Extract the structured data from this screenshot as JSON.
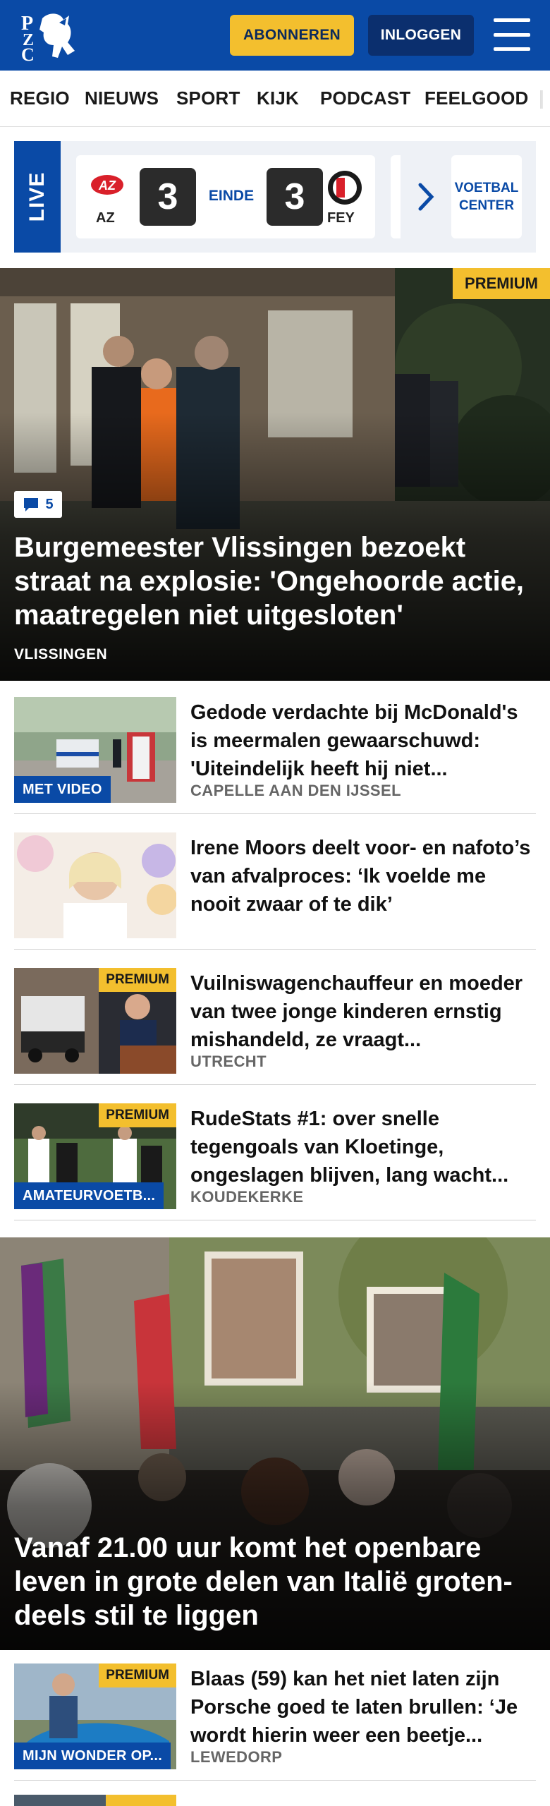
{
  "header": {
    "subscribe_label": "ABONNEREN",
    "login_label": "INLOGGEN",
    "brand_color": "#0a4aa6",
    "accent_color": "#f3bf2e"
  },
  "nav": {
    "items": [
      "REGIO",
      "NIEUWS",
      "SPORT",
      "KIJK",
      "PODCAST",
      "FEELGOOD"
    ]
  },
  "live": {
    "label": "LIVE",
    "match": {
      "home_team": "AZ",
      "home_score": "3",
      "status": "EINDE",
      "away_score": "3",
      "away_team": "FEY"
    },
    "voetbal_center": "VOETBAL CENTER"
  },
  "hero_article": {
    "badge": "PREMIUM",
    "comments": "5",
    "title": "Burgemeester Vlissingen bezoekt straat na explosie: 'Ongehoorde actie, maatregelen niet uitgesloten'",
    "location": "VLISSINGEN"
  },
  "articles": [
    {
      "tag": "MET VIDEO",
      "title": "Gedode verdachte bij McDonald's is meermalen gewaarschuwd: 'Uiteindelijk heeft hij niet...",
      "location": "CAPELLE AAN DEN IJSSEL"
    },
    {
      "title": "Irene Moors deelt voor- en nafoto’s van afvalproces: ‘Ik voelde me nooit zwaar of te dik’"
    },
    {
      "badge": "PREMIUM",
      "title": "Vuilniswagenchauffeur en moeder van twee jonge kinderen ernstig mishandeld, ze vraagt...",
      "location": "UTRECHT"
    },
    {
      "badge": "PREMIUM",
      "tag": "AMATEURVOETB...",
      "title": "RudeStats #1: over snelle tegengoals van Kloetinge, ongeslagen blijven, lang wacht...",
      "location": "KOUDEKERKE"
    }
  ],
  "hero_article_2": {
    "title": "Vanaf 21.00 uur komt het openbare leven in grote delen van Italië groten-deels stil te liggen"
  },
  "articles_2": [
    {
      "badge": "PREMIUM",
      "tag": "MIJN WONDER OP...",
      "title": "Blaas (59) kan het niet laten zijn Porsche goed te laten brullen: ‘Je wordt hierin weer een beetje...",
      "location": "LEWEDORP"
    }
  ]
}
